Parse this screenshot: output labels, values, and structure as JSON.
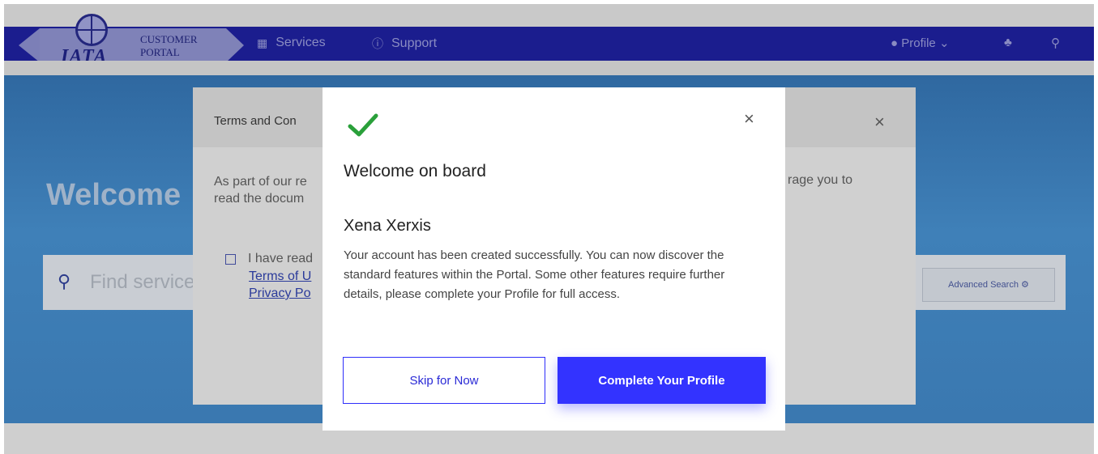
{
  "header": {
    "logo_brand": "IATA",
    "logo_line1": "CUSTOMER",
    "logo_line2": "PORTAL",
    "nav_services": "Services",
    "nav_support": "Support",
    "nav_profile": "Profile"
  },
  "background": {
    "welcome_heading": "Welcome",
    "search_placeholder": "Find service",
    "advanced_search": "Advanced Search"
  },
  "terms_modal": {
    "title": "Terms and Con",
    "body_line1": "As part of our re",
    "body_line2": "read the docum",
    "body_right": "rage you to",
    "checkbox_text": "I have read",
    "link_terms": "Terms of U",
    "link_privacy": "Privacy Po",
    "close_symbol": "×"
  },
  "dialog": {
    "title": "Welcome on board",
    "user_name": "Xena Xerxis",
    "message": "Your account has been created successfully. You can now discover the standard features within the Portal. Some other features require further details, please complete your Profile for full access.",
    "skip_label": "Skip for Now",
    "complete_label": "Complete Your Profile",
    "close_symbol": "×"
  },
  "icons": {
    "check": "checkmark-icon",
    "services": "services-icon",
    "support": "help-circle-icon",
    "profile": "user-icon",
    "notifications": "bell-icon",
    "search": "search-icon",
    "settings": "gear-icon"
  },
  "colors": {
    "nav_bg": "#1b1d8e",
    "primary_button": "#3333ff",
    "check_green": "#2aa03a"
  }
}
